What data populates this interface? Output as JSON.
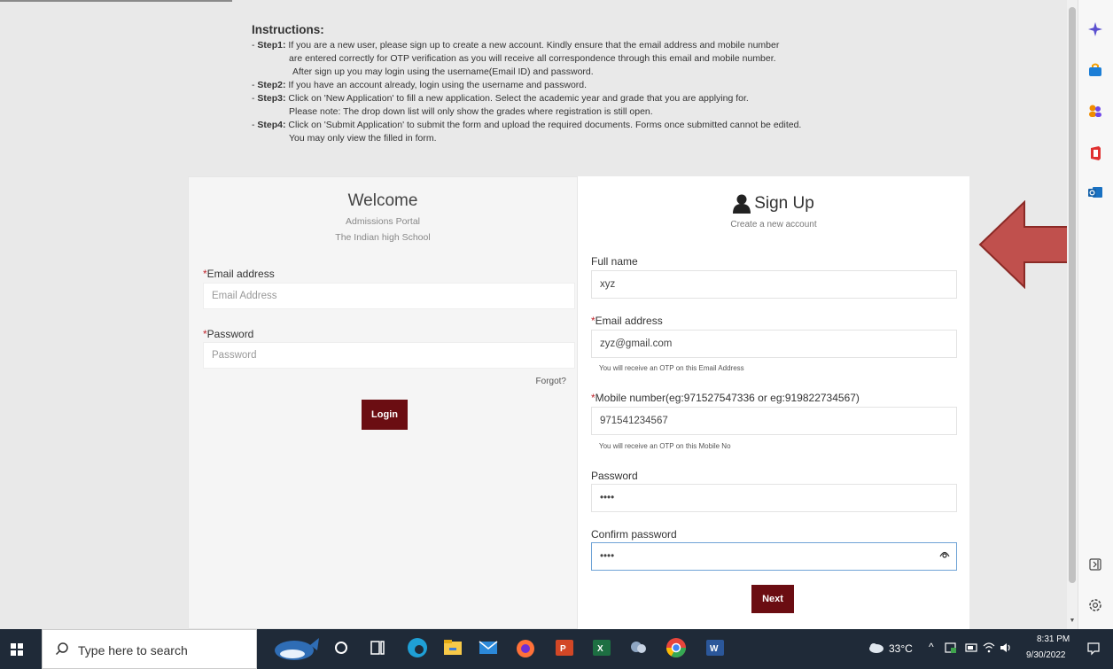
{
  "instructions": {
    "title": "Instructions:",
    "step1_label": "Step1:",
    "step1_text": " If you are a new user, please sign up to create a new account. Kindly ensure that the email address and mobile number",
    "step1_line2": "are entered correctly for OTP verification as you will receive all correspondence through this email and mobile number.",
    "step1_line3": "After sign up you may login using the username(Email ID) and password.",
    "step2_label": "Step2:",
    "step2_text": " If you have an account already, login using the username and password.",
    "step3_label": "Step3:",
    "step3_text": " Click on 'New Application' to fill a new application. Select the academic year and grade that you are applying for.",
    "step3_line2": "Please note: The drop down list will only show the grades where registration is still open.",
    "step4_label": "Step4:",
    "step4_text": " Click on 'Submit Application' to submit the form and upload the required documents. Forms once submitted cannot be edited.",
    "step4_line2": "You may only view the filled in form.",
    "bullet": "- "
  },
  "login": {
    "welcome": "Welcome",
    "portal": "Admissions Portal",
    "school": "The Indian high School",
    "email_label": "Email address",
    "email_placeholder": "Email Address",
    "password_label": "Password",
    "password_placeholder": "Password",
    "forgot": "Forgot?",
    "login_button": "Login",
    "required_mark": "*"
  },
  "signup": {
    "title": "Sign Up",
    "subtitle": "Create a new account",
    "fullname_label": "Full name",
    "fullname_value": "xyz",
    "email_label": "Email address",
    "email_value": "zyz@gmail.com",
    "email_hint": "You will receive an OTP on this Email Address",
    "mobile_label": "Mobile number(eg:971527547336 or eg:919822734567)",
    "mobile_value": "971541234567",
    "mobile_hint": "You will receive an OTP on this Mobile No",
    "password_label": "Password",
    "password_value": "••••",
    "confirm_label": "Confirm password",
    "confirm_value": "••••",
    "next_button": "Next",
    "required_mark": "*"
  },
  "taskbar": {
    "search_placeholder": "Type here to search",
    "weather": "33°C",
    "time": "8:31 PM",
    "date": "9/30/2022"
  },
  "colors": {
    "accent_button": "#6b0d12",
    "arrow_fill": "#c0504d",
    "arrow_stroke": "#8b2a26",
    "required": "#c0262d"
  }
}
